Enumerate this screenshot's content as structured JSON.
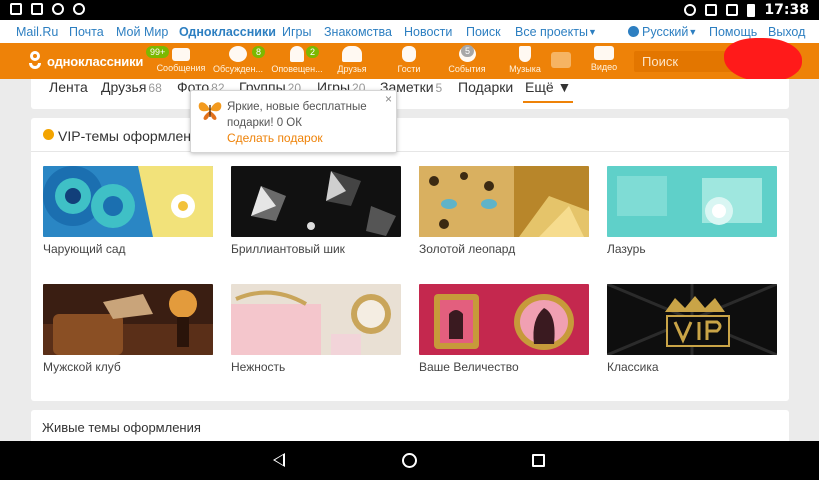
{
  "status_bar": {
    "time": "17:38",
    "left_icons": [
      "play-icon",
      "image-icon",
      "search-icon",
      "settings-icon"
    ],
    "right_icons": [
      "headset-icon",
      "no-sound-icon",
      "wifi-icon",
      "battery-icon"
    ]
  },
  "top_nav": {
    "links": [
      "Mail.Ru",
      "Почта",
      "Мой Мир",
      "Одноклассники",
      "Игры",
      "Знакомства",
      "Новости",
      "Поиск",
      "Все проекты"
    ],
    "active": "Одноклассники",
    "language": "Русский",
    "help": "Помощь",
    "logout": "Выход"
  },
  "toolbar": {
    "logo_text": "одноклассники",
    "logo_badge": "99+",
    "items": [
      {
        "label": "Сообщения",
        "icon": "envelope-icon",
        "badge": ""
      },
      {
        "label": "Обсужден...",
        "icon": "chat-icon",
        "badge": "8"
      },
      {
        "label": "Оповещен...",
        "icon": "bell-icon",
        "badge": "2"
      },
      {
        "label": "Друзья",
        "icon": "friends-icon",
        "badge": ""
      },
      {
        "label": "Гости",
        "icon": "footprints-icon",
        "badge": ""
      },
      {
        "label": "События",
        "icon": "events-icon",
        "badge": "5"
      },
      {
        "label": "Музыка",
        "icon": "music-icon",
        "badge": ""
      },
      {
        "label": "Видео",
        "icon": "video-icon",
        "badge": ""
      }
    ],
    "search_placeholder": "Поиск"
  },
  "profile_tabs": [
    {
      "label": "Лента",
      "count": ""
    },
    {
      "label": "Друзья",
      "count": "68"
    },
    {
      "label": "Фото",
      "count": "82"
    },
    {
      "label": "Группы",
      "count": "20"
    },
    {
      "label": "Игры",
      "count": "20"
    },
    {
      "label": "Заметки",
      "count": "5"
    },
    {
      "label": "Подарки",
      "count": ""
    },
    {
      "label": "Ещё ▼",
      "count": ""
    }
  ],
  "popup": {
    "message": "Яркие, новые бесплатные подарки! 0 ОК",
    "link": "Сделать подарок",
    "close": "×"
  },
  "vip_panel": {
    "title": "VIP-темы оформления",
    "themes": [
      {
        "name": "Чарующий сад",
        "colors": [
          "#1b6fb0",
          "#3fc0c6",
          "#f2e27a"
        ]
      },
      {
        "name": "Бриллиантовый шик",
        "colors": [
          "#111111",
          "#6a6a6a",
          "#e6e6e6"
        ]
      },
      {
        "name": "Золотой леопард",
        "colors": [
          "#b8862a",
          "#e5c46a",
          "#3c2a12"
        ]
      },
      {
        "name": "Лазурь",
        "colors": [
          "#5fd0c9",
          "#9fe7df",
          "#d9f6f3"
        ]
      },
      {
        "name": "Мужской клуб",
        "colors": [
          "#3a1e12",
          "#8a4f24",
          "#e39b3c"
        ]
      },
      {
        "name": "Нежность",
        "colors": [
          "#f4c6cc",
          "#e9e0d4",
          "#c9a55a"
        ]
      },
      {
        "name": "Ваше Величество",
        "colors": [
          "#c4284e",
          "#e35f7e",
          "#c79a3a"
        ]
      },
      {
        "name": "Классика",
        "colors": [
          "#0e0e0e",
          "#2b2b2b",
          "#c9a447"
        ]
      }
    ]
  },
  "live_panel": {
    "title": "Живые темы оформления"
  }
}
